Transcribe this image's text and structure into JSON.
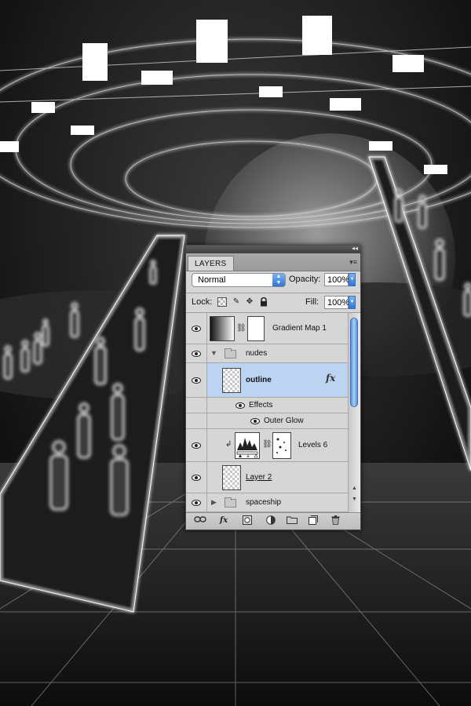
{
  "panel": {
    "tab_label": "LAYERS",
    "collapse_glyph": "◂◂",
    "menu_glyph": "▾≡",
    "blend_mode": "Normal",
    "opacity_label": "Opacity:",
    "opacity_value": "100%",
    "lock_label": "Lock:",
    "fill_label": "Fill:",
    "fill_value": "100%"
  },
  "layers": [
    {
      "name": "Gradient Map 1",
      "type": "adjustment-gradient-map",
      "visible": true
    },
    {
      "name": "nudes",
      "type": "group",
      "expanded": true,
      "visible": true
    },
    {
      "name": "outline",
      "type": "pixel",
      "selected": true,
      "has_fx": true,
      "visible": true
    },
    {
      "name": "Effects",
      "type": "effects-header",
      "visible": true
    },
    {
      "name": "Outer Glow",
      "type": "effect",
      "visible": true
    },
    {
      "name": "Levels 6",
      "type": "adjustment-levels",
      "clipped": true,
      "visible": true
    },
    {
      "name": "Layer 2",
      "type": "pixel",
      "visible": true
    },
    {
      "name": "spaceship",
      "type": "group",
      "expanded": false,
      "visible": true
    }
  ],
  "icons": {
    "fx_glyph": "fx",
    "expanded_triangle": "▼",
    "collapsed_triangle": "▶",
    "clip_arrow": "↲",
    "chain": "⛓",
    "scroll_up": "▲",
    "scroll_down": "▼"
  },
  "bottom_bar": [
    "link-layers",
    "add-style",
    "add-mask",
    "new-adjustment",
    "new-group",
    "new-layer",
    "delete-layer"
  ],
  "colors": {
    "panel_bg": "#d6d6d6",
    "selection": "#bcd4f2",
    "aqua_blue": "#2f76d8"
  }
}
